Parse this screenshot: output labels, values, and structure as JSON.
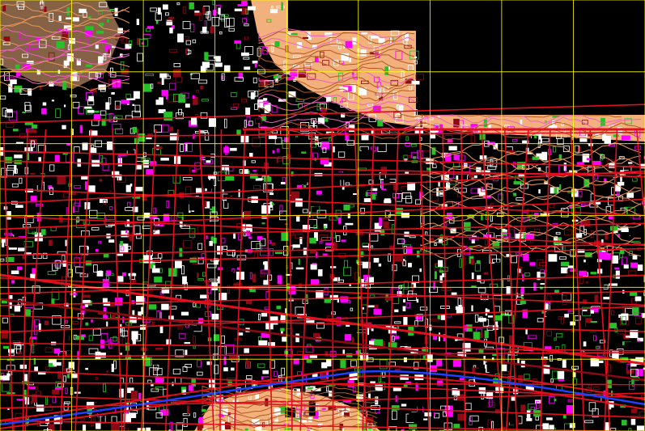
{
  "map": {
    "kind": "cad-city-plan",
    "background_color": "#000000",
    "colors": {
      "buildings": "#ffffff",
      "blocks_magenta": "#ff00ff",
      "streets_red": "#e0101e",
      "contours_orange": "#e8955a",
      "terrain_fill": "#f2b07d",
      "contour_pink": "#f060c0",
      "vegetation_green": "#28c028",
      "grid_yellow": "#ffff00",
      "highway_blue": "#2040ff",
      "dark_red": "#8b0a14"
    },
    "grid": {
      "columns": 9,
      "rows": 6,
      "line_color": "#ffff00"
    },
    "regions": [
      "dense-urban-grid",
      "northern-hills-contours",
      "southern-hills-contours",
      "unmapped-black-area-top-right",
      "river-highway-corridor"
    ]
  }
}
